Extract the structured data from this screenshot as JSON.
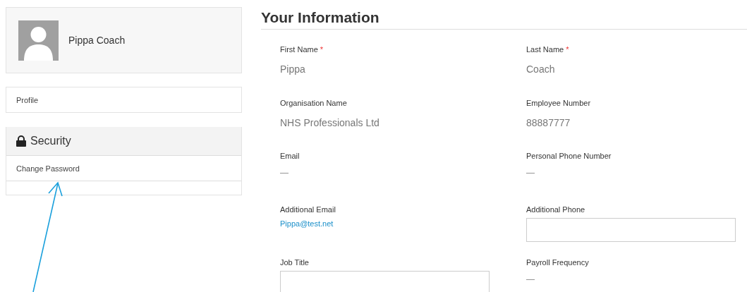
{
  "user": {
    "name": "Pippa Coach"
  },
  "nav": [
    {
      "label": "Profile"
    }
  ],
  "security": {
    "title": "Security",
    "items": [
      {
        "label": "Change Password"
      }
    ]
  },
  "section_title": "Your Information",
  "fields": [
    {
      "label": "First Name",
      "required": true,
      "kind": "text",
      "value": "Pippa"
    },
    {
      "label": "Last Name",
      "required": true,
      "kind": "text",
      "value": "Coach"
    },
    {
      "label": "Organisation Name",
      "required": false,
      "kind": "text",
      "value": "NHS Professionals Ltd"
    },
    {
      "label": "Employee Number",
      "required": false,
      "kind": "text",
      "value": "88887777"
    },
    {
      "label": "Email",
      "required": false,
      "kind": "empty",
      "value": "—"
    },
    {
      "label": "Personal Phone Number",
      "required": false,
      "kind": "empty",
      "value": "—"
    },
    {
      "label": "Additional Email",
      "required": false,
      "kind": "link",
      "value": "Pippa@test.net"
    },
    {
      "label": "Additional Phone",
      "required": false,
      "kind": "input"
    },
    {
      "label": "Job Title",
      "required": false,
      "kind": "input"
    },
    {
      "label": "Payroll Frequency",
      "required": false,
      "kind": "empty",
      "value": "—"
    }
  ],
  "required_mark": "*"
}
